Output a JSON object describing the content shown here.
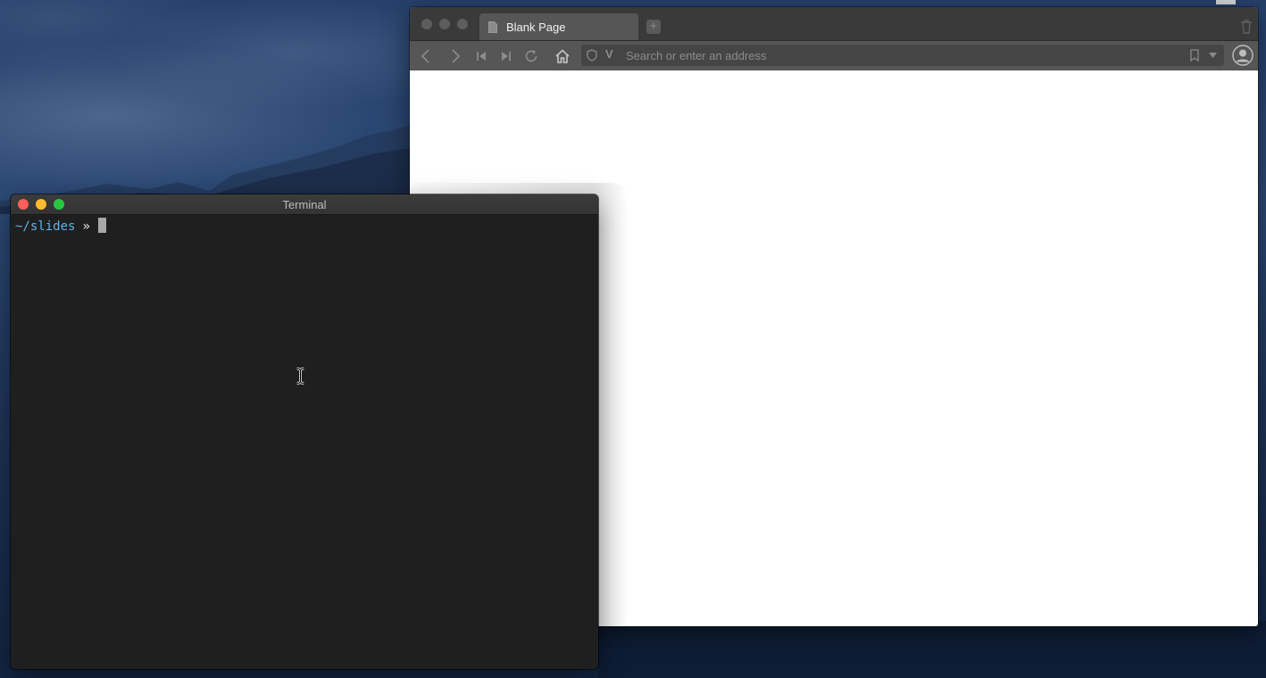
{
  "browser": {
    "tab_title": "Blank Page",
    "address_placeholder": "Search or enter an address",
    "address_prefix": "V",
    "new_tab_symbol": "+",
    "toolbar_icons": [
      "back-icon",
      "forward-icon",
      "rewind-icon",
      "fast-forward-icon",
      "reload-icon",
      "home-icon"
    ]
  },
  "terminal": {
    "title": "Terminal",
    "prompt_path": "~/slides",
    "prompt_symbol": "»"
  },
  "colors": {
    "terminal_bg": "#1f1f1f",
    "prompt_path": "#5fb2ee",
    "close": "#fe5f57",
    "minimize": "#febc2e",
    "zoom": "#28c840",
    "browser_chrome": "#565656"
  }
}
